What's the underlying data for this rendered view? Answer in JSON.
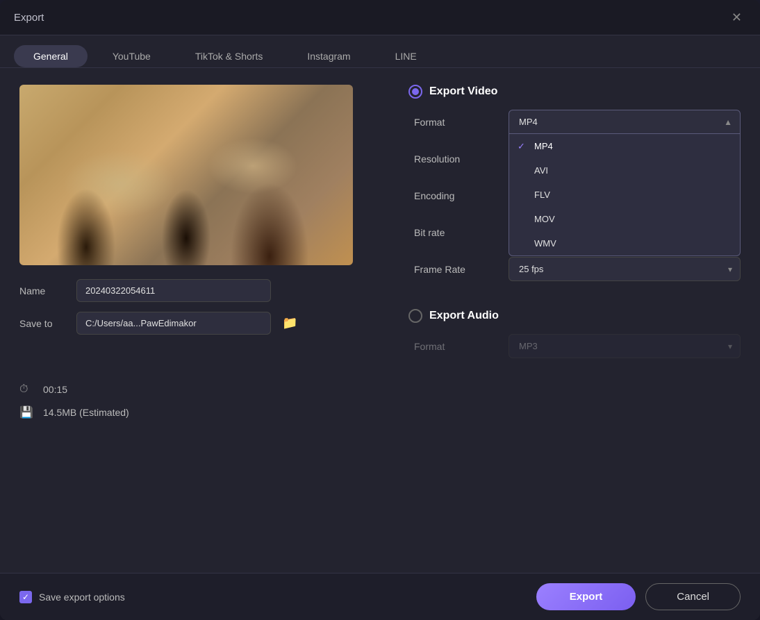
{
  "dialog": {
    "title": "Export",
    "close_label": "✕"
  },
  "tabs": [
    {
      "id": "general",
      "label": "General",
      "active": true
    },
    {
      "id": "youtube",
      "label": "YouTube",
      "active": false
    },
    {
      "id": "tiktok",
      "label": "TikTok & Shorts",
      "active": false
    },
    {
      "id": "instagram",
      "label": "Instagram",
      "active": false
    },
    {
      "id": "line",
      "label": "LINE",
      "active": false
    }
  ],
  "left_panel": {
    "name_label": "Name",
    "name_value": "20240322054611",
    "save_to_label": "Save to",
    "save_to_value": "C:/Users/aa...PawEdimakor",
    "stats": {
      "duration_icon": "⏱",
      "duration": "00:15",
      "size_icon": "💾",
      "size": "14.5MB (Estimated)"
    }
  },
  "right_panel": {
    "export_video_label": "Export Video",
    "format_label": "Format",
    "format_value": "MP4",
    "format_arrow": "▲",
    "resolution_label": "Resolution",
    "encoding_label": "Encoding",
    "bitrate_label": "Bit rate",
    "framerate_label": "Frame Rate",
    "framerate_value": "25  fps",
    "dropdown_items": [
      {
        "label": "MP4",
        "selected": true
      },
      {
        "label": "AVI",
        "selected": false
      },
      {
        "label": "FLV",
        "selected": false
      },
      {
        "label": "MOV",
        "selected": false
      },
      {
        "label": "WMV",
        "selected": false
      }
    ],
    "export_audio_label": "Export Audio",
    "audio_format_label": "Format",
    "audio_format_value": "MP3"
  },
  "bottom_bar": {
    "save_options_label": "Save export options",
    "export_button": "Export",
    "cancel_button": "Cancel"
  }
}
